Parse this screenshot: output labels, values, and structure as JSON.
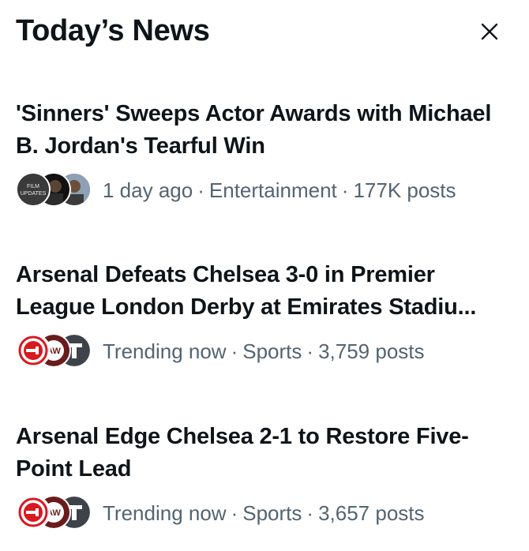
{
  "header": {
    "title": "Today’s News"
  },
  "icons": {
    "close": "close-icon"
  },
  "news": [
    {
      "headline": "'Sinners' Sweeps Actor Awards with Michael B. Jordan's Tearful Win",
      "time": "1 day ago",
      "category": "Entertainment",
      "posts": "177K posts",
      "avatar_text": "FILM UPDATES"
    },
    {
      "headline": "Arsenal Defeats Chelsea 3-0 in Premier League London Derby at Emirates Stadiu...",
      "time": "Trending now",
      "category": "Sports",
      "posts": "3,759 posts",
      "avatar_text": "AW"
    },
    {
      "headline": "Arsenal Edge Chelsea 2-1 to Restore Five-Point Lead",
      "time": "Trending now",
      "category": "Sports",
      "posts": "3,657 posts",
      "avatar_text": "AW"
    }
  ],
  "colors": {
    "text_primary": "#0f1419",
    "text_secondary": "#536471",
    "arsenal_red": "#d71920",
    "maroon": "#6b1b1b"
  }
}
